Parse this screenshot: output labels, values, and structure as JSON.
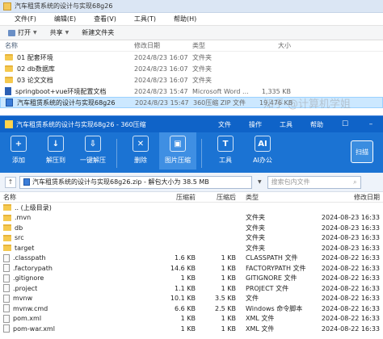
{
  "explorer": {
    "title": "汽车租赁系统的设计与实现68g26",
    "menu": [
      "文件(F)",
      "编辑(E)",
      "查看(V)",
      "工具(T)",
      "帮助(H)"
    ],
    "toolbar": [
      "打开",
      "共享",
      "新建文件夹"
    ],
    "columns": [
      "名称",
      "修改日期",
      "类型",
      "大小"
    ],
    "rows": [
      {
        "name": "01 配套环境",
        "date": "2024/8/23 16:07",
        "type": "文件夹",
        "size": "",
        "icon": "folder-icon"
      },
      {
        "name": "02 db数据库",
        "date": "2024/8/23 16:07",
        "type": "文件夹",
        "size": "",
        "icon": "folder-icon"
      },
      {
        "name": "03 论文文档",
        "date": "2024/8/23 16:07",
        "type": "文件夹",
        "size": "",
        "icon": "folder-icon"
      },
      {
        "name": "springboot+vue环境配置文档",
        "date": "2024/8/23 15:47",
        "type": "Microsoft Word ...",
        "size": "1,335 KB",
        "icon": "word-icon"
      },
      {
        "name": "汽车租赁系统的设计与实现68g26",
        "date": "2024/8/23 15:47",
        "type": "360压缩 ZIP 文件",
        "size": "19,476 KB",
        "icon": "zip-icon",
        "selected": true
      }
    ]
  },
  "zip": {
    "title": "汽车租赁系统的设计与实现68g26 - 360压缩",
    "title_menu": [
      "文件",
      "操作",
      "工具",
      "帮助"
    ],
    "ribbon": [
      {
        "label": "添加",
        "icon": "add-icon",
        "color": "#ffffff",
        "glyph": "+"
      },
      {
        "label": "解压到",
        "icon": "extract-to-icon",
        "color": "#ffffff",
        "glyph": "↓"
      },
      {
        "label": "一键解压",
        "icon": "one-click-extract-icon",
        "color": "#ffffff",
        "glyph": "⇩"
      },
      {
        "label": "删除",
        "icon": "delete-icon",
        "color": "#ffffff",
        "glyph": "✕"
      },
      {
        "label": "图片压缩",
        "icon": "image-compress-icon",
        "color": "#ffffff",
        "glyph": "▣"
      },
      {
        "label": "工具",
        "icon": "tools-icon",
        "color": "#ffffff",
        "glyph": "T"
      },
      {
        "label": "AI办公",
        "icon": "ai-office-icon",
        "color": "#ffffff",
        "glyph": "AI"
      }
    ],
    "scan_label": "扫描",
    "path": "汽车租赁系统的设计与实现68g26.zip - 解包大小为 38.5 MB",
    "search_placeholder": "搜索包内文件",
    "columns": [
      "名称",
      "压缩前",
      "压缩后",
      "类型",
      "修改日期"
    ],
    "rows": [
      {
        "name": ".. (上级目录)",
        "comp": "",
        "size": "",
        "type": "",
        "date": "",
        "kind": "up"
      },
      {
        "name": ".mvn",
        "comp": "",
        "size": "",
        "type": "文件夹",
        "date": "2024-08-23 16:33",
        "kind": "folder"
      },
      {
        "name": "db",
        "comp": "",
        "size": "",
        "type": "文件夹",
        "date": "2024-08-23 16:33",
        "kind": "folder"
      },
      {
        "name": "src",
        "comp": "",
        "size": "",
        "type": "文件夹",
        "date": "2024-08-23 16:33",
        "kind": "folder"
      },
      {
        "name": "target",
        "comp": "",
        "size": "",
        "type": "文件夹",
        "date": "2024-08-23 16:33",
        "kind": "folder"
      },
      {
        "name": ".classpath",
        "comp": "1.6 KB",
        "size": "1 KB",
        "type": "CLASSPATH 文件",
        "date": "2024-08-22 16:33",
        "kind": "file"
      },
      {
        "name": ".factorypath",
        "comp": "14.6 KB",
        "size": "1 KB",
        "type": "FACTORYPATH 文件",
        "date": "2024-08-22 16:33",
        "kind": "file"
      },
      {
        "name": ".gitignore",
        "comp": "1 KB",
        "size": "1 KB",
        "type": "GITIGNORE 文件",
        "date": "2024-08-22 16:33",
        "kind": "file"
      },
      {
        "name": ".project",
        "comp": "1.1 KB",
        "size": "1 KB",
        "type": "PROJECT 文件",
        "date": "2024-08-22 16:33",
        "kind": "file"
      },
      {
        "name": "mvnw",
        "comp": "10.1 KB",
        "size": "3.5 KB",
        "type": "文件",
        "date": "2024-08-22 16:33",
        "kind": "file"
      },
      {
        "name": "mvnw.cmd",
        "comp": "6.6 KB",
        "size": "2.5 KB",
        "type": "Windows 命令脚本",
        "date": "2024-08-22 16:33",
        "kind": "file"
      },
      {
        "name": "pom.xml",
        "comp": "1 KB",
        "size": "1 KB",
        "type": "XML 文件",
        "date": "2024-08-22 16:33",
        "kind": "file"
      },
      {
        "name": "pom-war.xml",
        "comp": "1 KB",
        "size": "1 KB",
        "type": "XML 文件",
        "date": "2024-08-22 16:33",
        "kind": "file"
      }
    ]
  },
  "watermark": "知乎 @计算机学姐"
}
